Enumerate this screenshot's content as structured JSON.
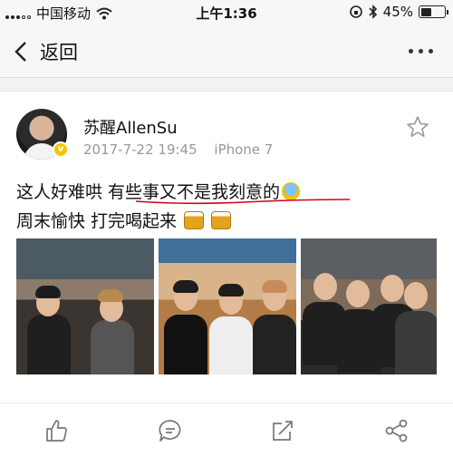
{
  "status_bar": {
    "carrier": "中国移动",
    "time": "上午1:36",
    "battery_percent": "45%",
    "battery_level": 0.45
  },
  "nav": {
    "back_label": "返回"
  },
  "post": {
    "user_name": "苏醒AllenSu",
    "date": "2017-7-22 19:45",
    "device": "iPhone 7",
    "text_line1_a": "这人好难哄 ",
    "text_line1_b": "有些事又不是我刻意的",
    "text_line2": "周末愉快 打完喝起来"
  },
  "colors": {
    "accent_underline": "#d0021b",
    "verified_badge": "#f5c600",
    "meta_gray": "#999999"
  },
  "icons": [
    "back-chevron-icon",
    "more-dots-icon",
    "star-icon",
    "like-icon",
    "comment-icon",
    "repost-icon",
    "share-icon"
  ]
}
